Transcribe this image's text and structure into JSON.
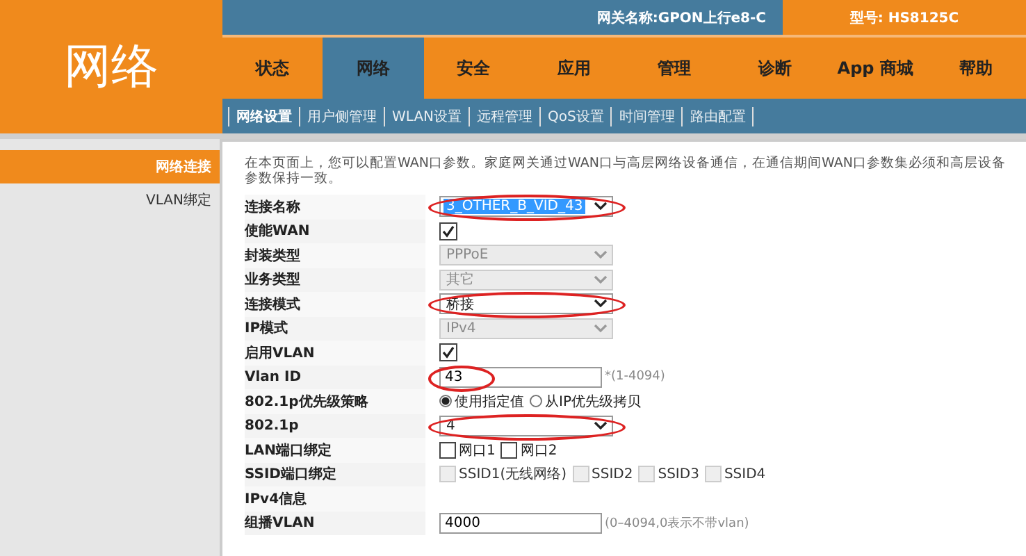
{
  "page_title": "网络",
  "gateway_name": "网关名称:GPON上行e8-C",
  "model": "型号: HS8125C",
  "tabs": [
    {
      "label": "状态",
      "selected": false
    },
    {
      "label": "网络",
      "selected": true
    },
    {
      "label": "安全",
      "selected": false
    },
    {
      "label": "应用",
      "selected": false
    },
    {
      "label": "管理",
      "selected": false
    },
    {
      "label": "诊断",
      "selected": false
    },
    {
      "label": "App 商城",
      "selected": false
    },
    {
      "label": "帮助",
      "selected": false
    }
  ],
  "subtabs": [
    {
      "label": "网络设置",
      "selected": true
    },
    {
      "label": "用户侧管理",
      "selected": false
    },
    {
      "label": "WLAN设置",
      "selected": false
    },
    {
      "label": "远程管理",
      "selected": false
    },
    {
      "label": "QoS设置",
      "selected": false
    },
    {
      "label": "时间管理",
      "selected": false
    },
    {
      "label": "路由配置",
      "selected": false
    }
  ],
  "sidebar": {
    "items": [
      {
        "label": "网络连接",
        "selected": true
      },
      {
        "label": "VLAN绑定",
        "selected": false
      }
    ]
  },
  "intro": "在本页面上，您可以配置WAN口参数。家庭网关通过WAN口与高层网络设备通信，在通信期间WAN口参数集必须和高层设备参数保持一致。",
  "form": [
    {
      "kind": "select",
      "label": "连接名称",
      "value": "3_OTHER_B_VID_43",
      "disabled": false,
      "highlighted": true,
      "circled": true
    },
    {
      "kind": "checkbox",
      "label": "使能WAN",
      "checked": true
    },
    {
      "kind": "select",
      "label": "封装类型",
      "value": "PPPoE",
      "disabled": true,
      "highlighted": false,
      "circled": false
    },
    {
      "kind": "select",
      "label": "业务类型",
      "value": "其它",
      "disabled": true,
      "highlighted": false,
      "circled": false
    },
    {
      "kind": "select",
      "label": "连接模式",
      "value": "桥接",
      "disabled": false,
      "highlighted": false,
      "circled": true
    },
    {
      "kind": "select",
      "label": "IP模式",
      "value": "IPv4",
      "disabled": true,
      "highlighted": false,
      "circled": false
    },
    {
      "kind": "checkbox",
      "label": "启用VLAN",
      "checked": true
    },
    {
      "kind": "text",
      "label": "Vlan ID",
      "value": "43",
      "hint": "*(1-4094)",
      "circled": true
    },
    {
      "kind": "radio",
      "label": "802.1p优先级策略",
      "options": [
        {
          "label": "使用指定值",
          "selected": true
        },
        {
          "label": "从IP优先级拷贝",
          "selected": false
        }
      ]
    },
    {
      "kind": "select",
      "label": "802.1p",
      "value": "4",
      "disabled": false,
      "highlighted": false,
      "circled": true
    },
    {
      "kind": "checkgroup",
      "label": "LAN端口绑定",
      "options": [
        {
          "label": "网口1",
          "checked": false,
          "disabled": false
        },
        {
          "label": "网口2",
          "checked": false,
          "disabled": false
        }
      ]
    },
    {
      "kind": "checkgroup",
      "label": "SSID端口绑定",
      "options": [
        {
          "label": "SSID1(无线网络)",
          "checked": false,
          "disabled": true
        },
        {
          "label": "SSID2",
          "checked": false,
          "disabled": true
        },
        {
          "label": "SSID3",
          "checked": false,
          "disabled": true
        },
        {
          "label": "SSID4",
          "checked": false,
          "disabled": true
        }
      ]
    },
    {
      "kind": "section",
      "label": "IPv4信息"
    },
    {
      "kind": "text",
      "label": "组播VLAN",
      "value": "4000",
      "hint": "(0–4094,0表示不带vlan)",
      "circled": false
    }
  ]
}
